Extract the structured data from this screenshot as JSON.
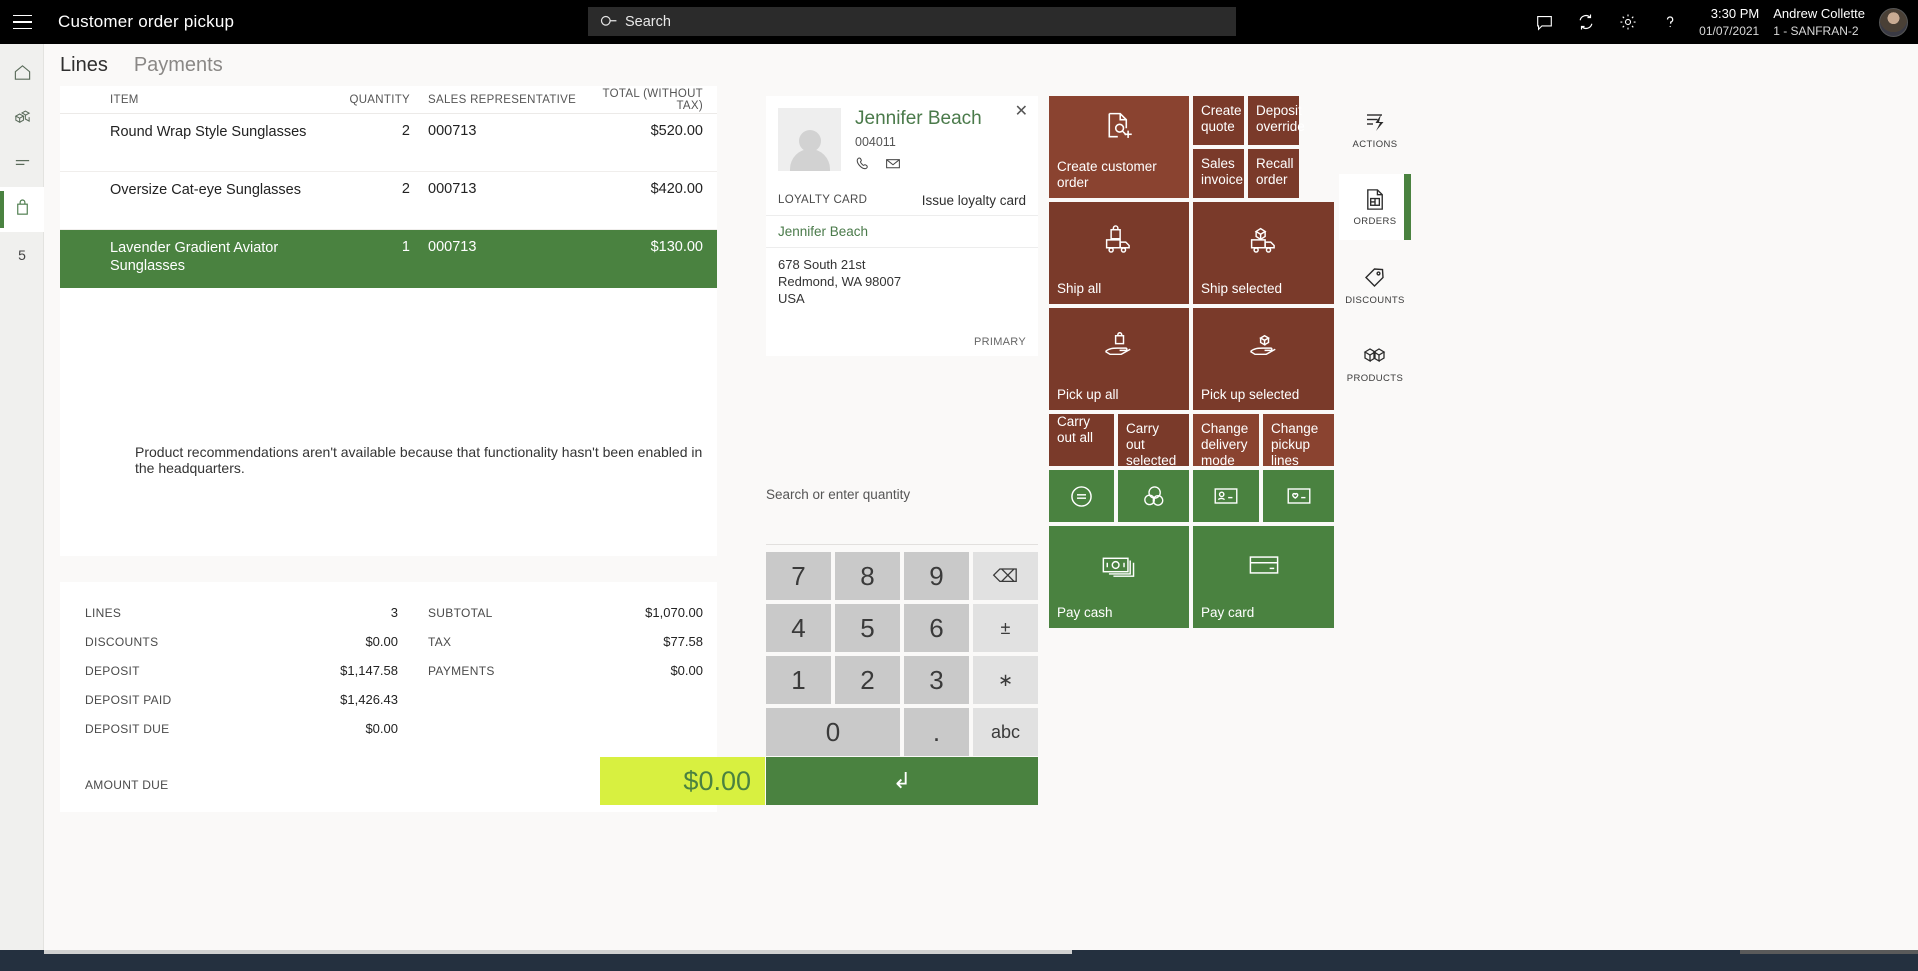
{
  "topbar": {
    "app_title": "Customer order pickup",
    "menu_icon": "hamburger-icon",
    "search_placeholder": "Search",
    "search_icon": "search-icon",
    "icons": [
      "feedback-icon",
      "sync-icon",
      "settings-icon",
      "help-icon"
    ],
    "time": "3:30 PM",
    "date": "01/07/2021",
    "user_name": "Andrew Collette",
    "user_store": "1 - SANFRAN-2"
  },
  "leftnav": {
    "items": [
      {
        "name": "home",
        "icon": "home-icon"
      },
      {
        "name": "products",
        "icon": "products-icon"
      },
      {
        "name": "transactions",
        "icon": "list-icon"
      },
      {
        "name": "cart",
        "icon": "bag-icon",
        "active": true
      },
      {
        "name": "count",
        "badge": "5"
      }
    ]
  },
  "tabs": [
    {
      "label": "Lines",
      "active": true
    },
    {
      "label": "Payments",
      "active": false
    }
  ],
  "lines_table": {
    "columns": [
      "ITEM",
      "QUANTITY",
      "SALES REPRESENTATIVE",
      "TOTAL (WITHOUT TAX)"
    ],
    "rows": [
      {
        "item": "Round Wrap Style Sunglasses",
        "quantity": "2",
        "rep": "000713",
        "total": "$520.00",
        "selected": false
      },
      {
        "item": "Oversize Cat-eye Sunglasses",
        "quantity": "2",
        "rep": "000713",
        "total": "$420.00",
        "selected": false
      },
      {
        "item": "Lavender Gradient Aviator Sunglasses",
        "quantity": "1",
        "rep": "000713",
        "total": "$130.00",
        "selected": true
      }
    ]
  },
  "recommendation_note": "Product recommendations aren't available because that functionality hasn't been enabled in the headquarters.",
  "totals": {
    "left": [
      {
        "label": "LINES",
        "value": "3"
      },
      {
        "label": "DISCOUNTS",
        "value": "$0.00"
      },
      {
        "label": "DEPOSIT",
        "value": "$1,147.58"
      },
      {
        "label": "DEPOSIT PAID",
        "value": "$1,426.43"
      },
      {
        "label": "DEPOSIT DUE",
        "value": "$0.00"
      }
    ],
    "right": [
      {
        "label": "SUBTOTAL",
        "value": "$1,070.00"
      },
      {
        "label": "TAX",
        "value": "$77.58"
      },
      {
        "label": "PAYMENTS",
        "value": "$0.00"
      }
    ],
    "amount_due_label": "AMOUNT DUE",
    "amount_due_value": "$0.00",
    "enter_label": "↲"
  },
  "customer_card": {
    "name": "Jennifer Beach",
    "id": "004011",
    "phone_icon": "phone-icon",
    "email_icon": "envelope-icon",
    "close_icon": "close-icon",
    "loyalty_label": "LOYALTY CARD",
    "loyalty_action": "Issue loyalty card",
    "address_name": "Jennifer Beach",
    "address_line1": "678 South 21st",
    "address_line2": "Redmond, WA 98007",
    "address_line3": "USA",
    "primary_label": "PRIMARY"
  },
  "keypad": {
    "hint": "Search or enter quantity",
    "keys": [
      "7",
      "8",
      "9",
      "⌫",
      "4",
      "5",
      "6",
      "±",
      "1",
      "2",
      "3",
      "∗",
      "0",
      ".",
      "abc"
    ]
  },
  "tiles": {
    "create_customer_order": "Create customer order",
    "create_quote": "Create quote",
    "deposit_override": "Deposit override",
    "sales_invoice": "Sales invoice",
    "recall_order": "Recall order",
    "ship_all": "Ship all",
    "ship_selected": "Ship selected",
    "pick_up_all": "Pick up all",
    "pick_up_selected": "Pick up selected",
    "carry_out_all": "Carry out all",
    "carry_out_selected": "Carry out selected",
    "change_delivery_mode": "Change delivery mode",
    "change_pickup_lines": "Change pickup lines",
    "pay_cash": "Pay cash",
    "pay_card": "Pay card"
  },
  "rail": [
    {
      "label": "ACTIONS",
      "icon": "lightning-actions-icon",
      "active": false
    },
    {
      "label": "ORDERS",
      "icon": "orders-document-icon",
      "active": true
    },
    {
      "label": "DISCOUNTS",
      "icon": "discount-tag-icon",
      "active": false
    },
    {
      "label": "PRODUCTS",
      "icon": "products-boxes-icon",
      "active": false
    }
  ],
  "colors": {
    "accent_green": "#4a8240",
    "tile_red": "#8a4330",
    "tile_red_dark": "#7a3a2a",
    "amount_due_bg": "#d8f040",
    "topbar_bg": "#000000"
  }
}
